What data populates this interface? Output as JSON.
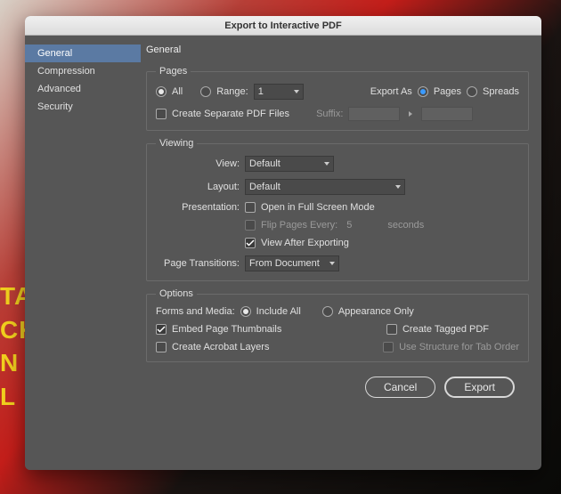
{
  "bg_text_lines": [
    "TA",
    "CKS",
    "N",
    "L"
  ],
  "dialog": {
    "title": "Export to Interactive PDF"
  },
  "sidebar": {
    "items": [
      {
        "label": "General",
        "active": true
      },
      {
        "label": "Compression",
        "active": false
      },
      {
        "label": "Advanced",
        "active": false
      },
      {
        "label": "Security",
        "active": false
      }
    ]
  },
  "main": {
    "heading": "General",
    "pages": {
      "legend": "Pages",
      "all_label": "All",
      "range_label": "Range:",
      "range_value": "1",
      "export_as_label": "Export As",
      "pages_label": "Pages",
      "spreads_label": "Spreads",
      "create_separate_label": "Create Separate PDF Files",
      "suffix_label": "Suffix:"
    },
    "viewing": {
      "legend": "Viewing",
      "view_label": "View:",
      "view_value": "Default",
      "layout_label": "Layout:",
      "layout_value": "Default",
      "presentation_label": "Presentation:",
      "open_full_label": "Open in Full Screen Mode",
      "flip_label": "Flip Pages Every:",
      "flip_value": "5",
      "seconds_label": "seconds",
      "view_after_label": "View After Exporting",
      "transitions_label": "Page Transitions:",
      "transitions_value": "From Document"
    },
    "options": {
      "legend": "Options",
      "forms_label": "Forms and Media:",
      "include_all_label": "Include All",
      "appearance_label": "Appearance Only",
      "embed_thumb_label": "Embed Page Thumbnails",
      "create_tagged_label": "Create Tagged PDF",
      "acrobat_layers_label": "Create Acrobat Layers",
      "tab_order_label": "Use Structure for Tab Order"
    }
  },
  "footer": {
    "cancel": "Cancel",
    "export": "Export"
  }
}
